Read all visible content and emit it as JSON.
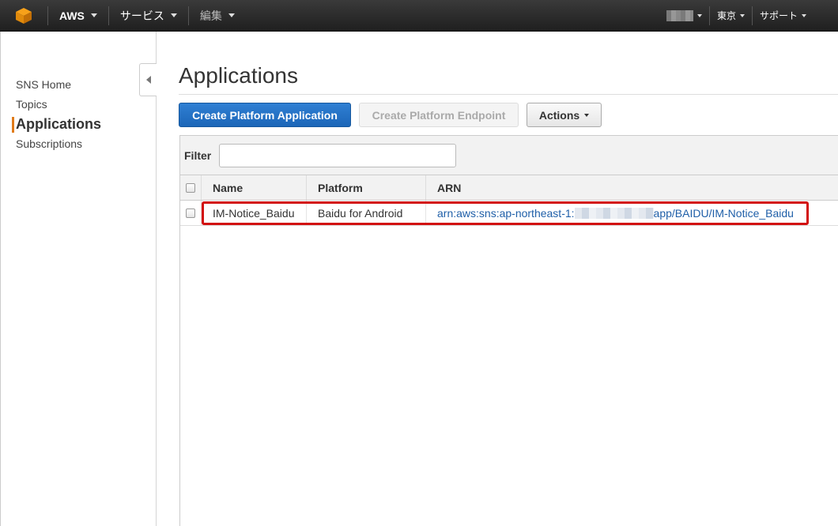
{
  "topnav": {
    "brand": "AWS",
    "services": "サービス",
    "edit": "編集",
    "region": "東京",
    "support": "サポート"
  },
  "sidebar": {
    "items": [
      {
        "label": "SNS Home"
      },
      {
        "label": "Topics"
      },
      {
        "label": "Applications"
      },
      {
        "label": "Subscriptions"
      }
    ],
    "active": "Applications"
  },
  "main": {
    "title": "Applications",
    "buttons": {
      "create_app": "Create Platform Application",
      "create_endpoint": "Create Platform Endpoint",
      "actions": "Actions"
    },
    "filter": {
      "label": "Filter",
      "value": ""
    },
    "table": {
      "columns": [
        "Name",
        "Platform",
        "ARN"
      ],
      "rows": [
        {
          "name": "IM-Notice_Baidu",
          "platform": "Baidu for Android",
          "arn_prefix": "arn:aws:sns:ap-northeast-1:",
          "arn_suffix": "app/BAIDU/IM-Notice_Baidu"
        }
      ]
    }
  },
  "colors": {
    "nav_bg": "#2b2b2b",
    "primary": "#1c66b8",
    "active_accent": "#e07b1a",
    "highlight": "#d20f0f",
    "link": "#1f5fa8"
  }
}
